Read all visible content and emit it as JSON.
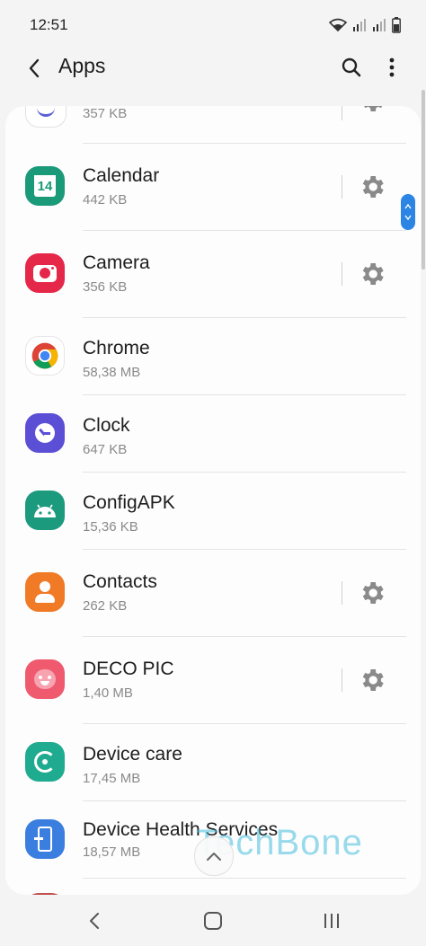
{
  "status_bar": {
    "time": "12:51"
  },
  "header": {
    "title": "Apps"
  },
  "apps": [
    {
      "name": "",
      "size": "357 KB",
      "has_settings": true,
      "icon": "app-icon"
    },
    {
      "name": "Calendar",
      "size": "442 KB",
      "has_settings": true,
      "icon": "calendar-icon",
      "icon_text": "14"
    },
    {
      "name": "Camera",
      "size": "356 KB",
      "has_settings": true,
      "icon": "camera-icon"
    },
    {
      "name": "Chrome",
      "size": "58,38 MB",
      "has_settings": false,
      "icon": "chrome-icon"
    },
    {
      "name": "Clock",
      "size": "647 KB",
      "has_settings": false,
      "icon": "clock-icon"
    },
    {
      "name": "ConfigAPK",
      "size": "15,36 KB",
      "has_settings": false,
      "icon": "android-icon"
    },
    {
      "name": "Contacts",
      "size": "262 KB",
      "has_settings": true,
      "icon": "contacts-icon"
    },
    {
      "name": "DECO PIC",
      "size": "1,40 MB",
      "has_settings": true,
      "icon": "deco-pic-icon"
    },
    {
      "name": "Device care",
      "size": "17,45 MB",
      "has_settings": false,
      "icon": "device-care-icon"
    },
    {
      "name": "Device Health Services",
      "size": "18,57 MB",
      "has_settings": false,
      "icon": "device-health-icon"
    }
  ],
  "watermark": "TechBone",
  "colors": {
    "accent": "#2c84e4",
    "calendar": "#1b9a79",
    "camera": "#e5284a",
    "clock": "#5b4fd6",
    "configapk": "#1b9a7e",
    "contacts": "#f07a26",
    "deco_pic": "#ef5a6e",
    "device_care": "#1eab8f",
    "device_health": "#3a7fe0"
  }
}
